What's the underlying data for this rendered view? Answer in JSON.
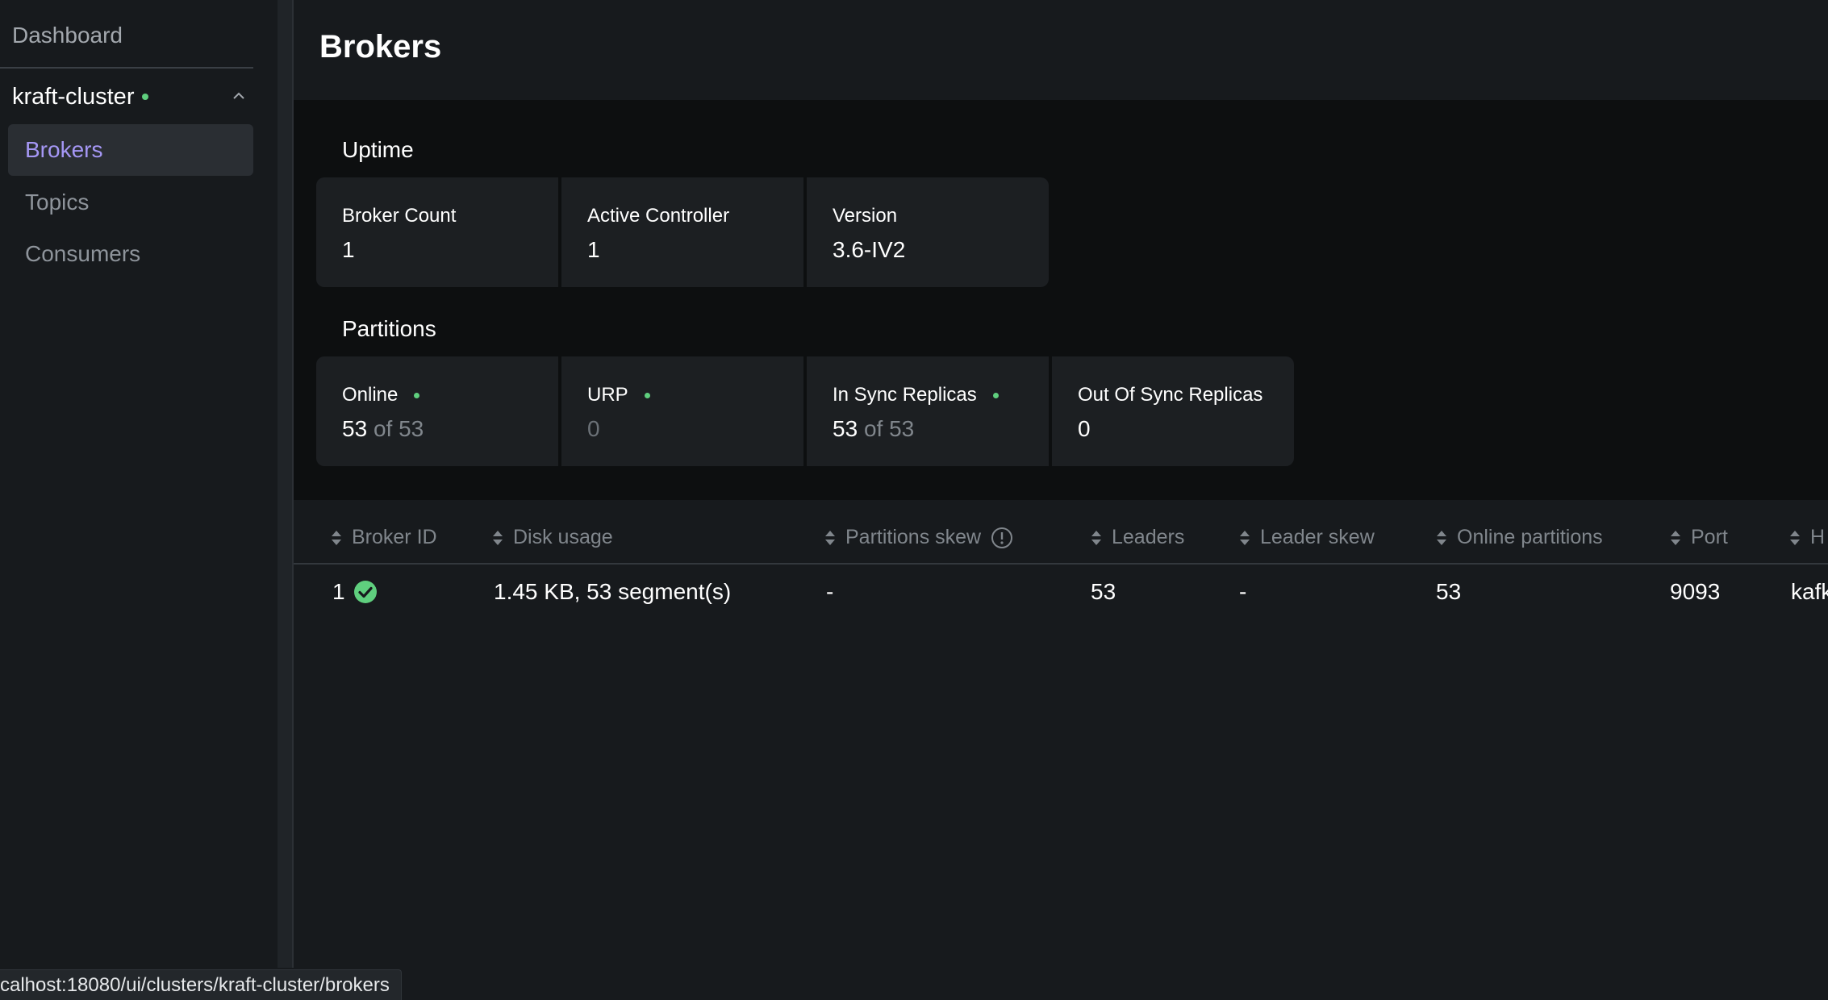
{
  "sidebar": {
    "dashboard_label": "Dashboard",
    "cluster_name": "kraft-cluster",
    "items": [
      {
        "label": "Brokers",
        "active": true
      },
      {
        "label": "Topics",
        "active": false
      },
      {
        "label": "Consumers",
        "active": false
      }
    ]
  },
  "page": {
    "title": "Brokers"
  },
  "uptime": {
    "title": "Uptime",
    "cards": [
      {
        "label": "Broker Count",
        "value": "1"
      },
      {
        "label": "Active Controller",
        "value": "1"
      },
      {
        "label": "Version",
        "value": "3.6-IV2"
      }
    ]
  },
  "partitions": {
    "title": "Partitions",
    "cards": [
      {
        "label": "Online",
        "value": "53",
        "suffix": "of 53",
        "status": "ok"
      },
      {
        "label": "URP",
        "value": "0",
        "status": "ok"
      },
      {
        "label": "In Sync Replicas",
        "value": "53",
        "suffix": "of 53",
        "status": "ok"
      },
      {
        "label": "Out Of Sync Replicas",
        "value": "0"
      }
    ]
  },
  "table": {
    "columns": [
      "Broker ID",
      "Disk usage",
      "Partitions skew",
      "Leaders",
      "Leader skew",
      "Online partitions",
      "Port",
      "H"
    ],
    "rows": [
      {
        "broker_id": "1",
        "disk_usage": "1.45 KB, 53 segment(s)",
        "partitions_skew": "-",
        "leaders": "53",
        "leader_skew": "-",
        "online_partitions": "53",
        "port": "9093",
        "host": "kafk"
      }
    ]
  },
  "status_url": "calhost:18080/ui/clusters/kraft-cluster/brokers",
  "colors": {
    "accent": "#a597f5",
    "status_ok": "#5fcf7e",
    "background": "#171a1d"
  }
}
